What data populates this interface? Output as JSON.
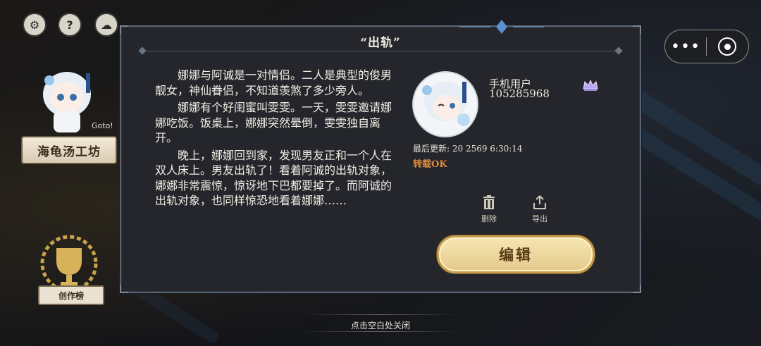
{
  "top_icons": [
    "settings-icon",
    "help-icon",
    "cloud-icon"
  ],
  "sidebar": {
    "shop_label": "海龟汤工坊",
    "goto_label": "Goto!",
    "rank_label": "创作榜"
  },
  "dialog": {
    "title": "“出轨”",
    "story_paragraphs": [
      "娜娜与阿诚是一对情侣。二人是典型的俊男靓女，神仙眷侣，不知道羡煞了多少旁人。",
      "娜娜有个好闺蜜叫雯雯。一天，雯雯邀请娜娜吃饭。饭桌上，娜娜突然晕倒，雯雯独自离开。",
      "晚上，娜娜回到家，发现男友正和一个人在双人床上。男友出轨了！看着阿诚的出轨对象，娜娜非常震惊，惊讶地下巴都要掉了。而阿诚的出轨对象，也同样惊恐地看着娜娜……"
    ],
    "author": {
      "name": "手机用户",
      "id": "105285968"
    },
    "updated": "最后更新: 20  2569 6:30:14",
    "repost_status": "转载OK",
    "actions": {
      "delete_label": "删除",
      "export_label": "导出"
    },
    "edit_label": "编辑"
  },
  "close_hint": "点击空白处关闭",
  "colors": {
    "dialog_bg": "#24262b",
    "accent_orange": "#e08a3c",
    "button_gold": "#e4c98a"
  }
}
